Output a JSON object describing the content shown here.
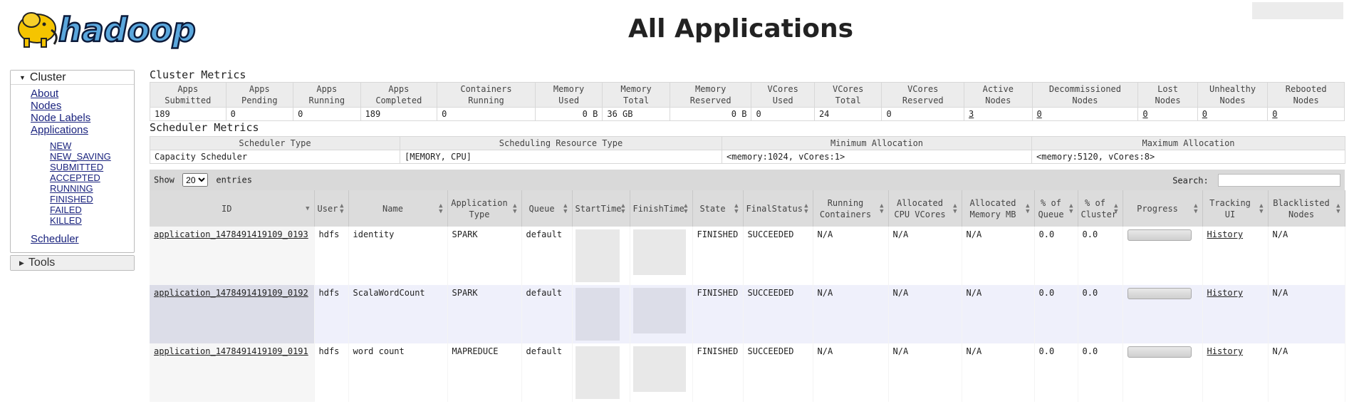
{
  "header": {
    "logo_text": "hadoop",
    "page_title": "All Applications"
  },
  "sidebar": {
    "cluster_label": "Cluster",
    "links": [
      {
        "label": "About"
      },
      {
        "label": "Nodes"
      },
      {
        "label": "Node Labels"
      },
      {
        "label": "Applications"
      }
    ],
    "app_states": [
      "NEW",
      "NEW_SAVING",
      "SUBMITTED",
      "ACCEPTED",
      "RUNNING",
      "FINISHED",
      "FAILED",
      "KILLED"
    ],
    "scheduler_label": "Scheduler",
    "tools_label": "Tools"
  },
  "cluster_metrics": {
    "title": "Cluster Metrics",
    "headers": [
      [
        "Apps",
        "Submitted"
      ],
      [
        "Apps",
        "Pending"
      ],
      [
        "Apps",
        "Running"
      ],
      [
        "Apps",
        "Completed"
      ],
      [
        "Containers",
        "Running"
      ],
      [
        "Memory",
        "Used"
      ],
      [
        "Memory",
        "Total"
      ],
      [
        "Memory",
        "Reserved"
      ],
      [
        "VCores",
        "Used"
      ],
      [
        "VCores",
        "Total"
      ],
      [
        "VCores",
        "Reserved"
      ],
      [
        "Active",
        "Nodes"
      ],
      [
        "Decommissioned",
        "Nodes"
      ],
      [
        "Lost",
        "Nodes"
      ],
      [
        "Unhealthy",
        "Nodes"
      ],
      [
        "Rebooted",
        "Nodes"
      ]
    ],
    "values": [
      "189",
      "0",
      "0",
      "189",
      "0",
      "0 B",
      "36 GB",
      "0 B",
      "0",
      "24",
      "0",
      "3",
      "0",
      "0",
      "0",
      "0"
    ]
  },
  "scheduler_metrics": {
    "title": "Scheduler Metrics",
    "headers": [
      "Scheduler Type",
      "Scheduling Resource Type",
      "Minimum Allocation",
      "Maximum Allocation"
    ],
    "values": [
      "Capacity Scheduler",
      "[MEMORY, CPU]",
      "<memory:1024, vCores:1>",
      "<memory:5120, vCores:8>"
    ]
  },
  "apps_table": {
    "show_label": "Show",
    "entries_value": "20",
    "entries_label": "entries",
    "search_label": "Search:",
    "search_value": "",
    "columns": [
      [
        "ID"
      ],
      [
        "User"
      ],
      [
        "Name"
      ],
      [
        "Application",
        "Type"
      ],
      [
        "Queue"
      ],
      [
        "StartTime"
      ],
      [
        "FinishTime"
      ],
      [
        "State"
      ],
      [
        "FinalStatus"
      ],
      [
        "Running",
        "Containers"
      ],
      [
        "Allocated",
        "CPU VCores"
      ],
      [
        "Allocated",
        "Memory MB"
      ],
      [
        "% of",
        "Queue"
      ],
      [
        "% of",
        "Cluster"
      ],
      [
        "Progress"
      ],
      [
        "Tracking",
        "UI"
      ],
      [
        "Blacklisted",
        "Nodes"
      ]
    ],
    "rows": [
      {
        "id": "application_1478491419109_0193",
        "user": "hdfs",
        "name": "identity",
        "type": "SPARK",
        "queue": "default",
        "state": "FINISHED",
        "final_status": "SUCCEEDED",
        "running_containers": "N/A",
        "alloc_vcores": "N/A",
        "alloc_memory": "N/A",
        "pct_queue": "0.0",
        "pct_cluster": "0.0",
        "progress": 1.0,
        "tracking_ui": "History",
        "blacklisted": "N/A"
      },
      {
        "id": "application_1478491419109_0192",
        "user": "hdfs",
        "name": "ScalaWordCount",
        "type": "SPARK",
        "queue": "default",
        "state": "FINISHED",
        "final_status": "SUCCEEDED",
        "running_containers": "N/A",
        "alloc_vcores": "N/A",
        "alloc_memory": "N/A",
        "pct_queue": "0.0",
        "pct_cluster": "0.0",
        "progress": 1.0,
        "tracking_ui": "History",
        "blacklisted": "N/A"
      },
      {
        "id": "application_1478491419109_0191",
        "user": "hdfs",
        "name": "word count",
        "type": "MAPREDUCE",
        "queue": "default",
        "state": "FINISHED",
        "final_status": "SUCCEEDED",
        "running_containers": "N/A",
        "alloc_vcores": "N/A",
        "alloc_memory": "N/A",
        "pct_queue": "0.0",
        "pct_cluster": "0.0",
        "progress": 1.0,
        "tracking_ui": "History",
        "blacklisted": "N/A"
      }
    ]
  },
  "colors": {
    "link": "#1a237e",
    "row_alt": "#eff0fb",
    "header_bg": "#dcdcdc",
    "logo_blue": "#5aa7dd",
    "elephant": "#f5c400"
  }
}
